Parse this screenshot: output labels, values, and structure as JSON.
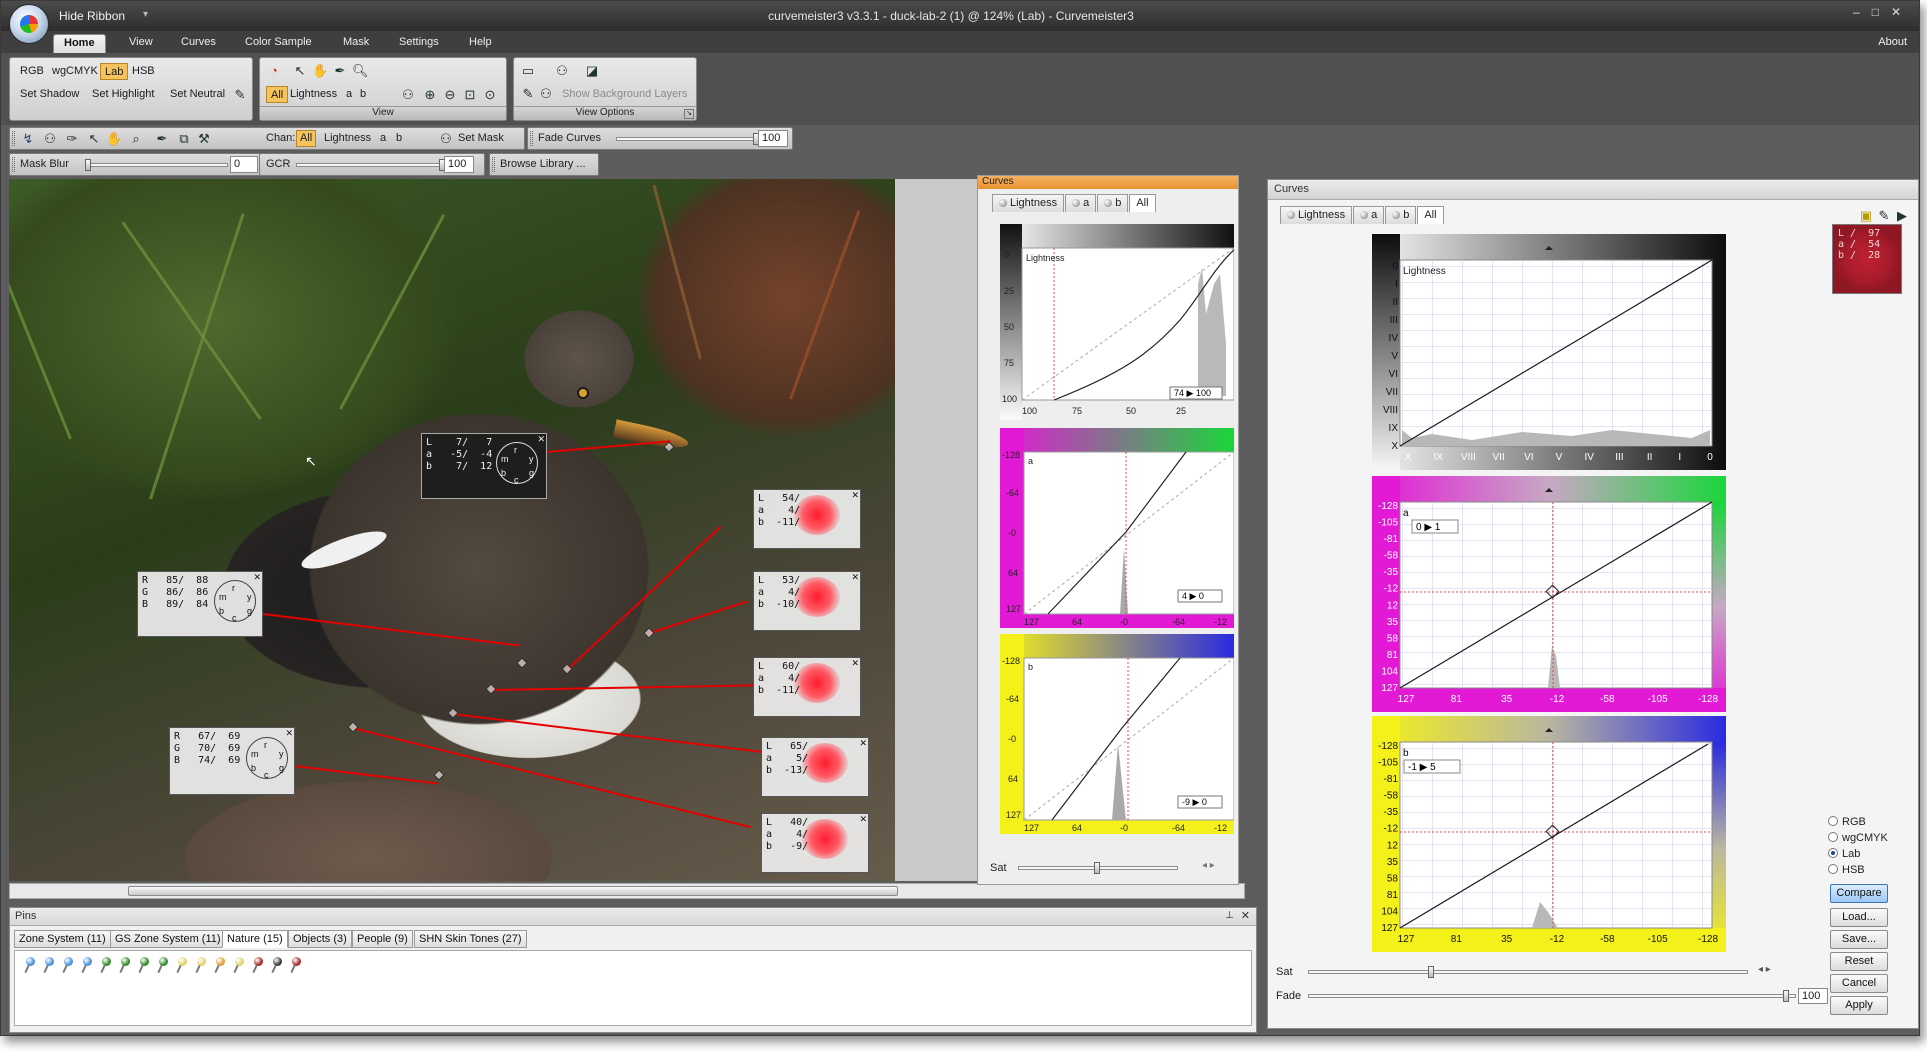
{
  "app": {
    "window_title": "curvemeister3 v3.3.1 - duck-lab-2 (1) @ 124% (Lab) - Curvemeister3",
    "hide_ribbon": "Hide Ribbon",
    "about": "About"
  },
  "ribbon": {
    "tabs": [
      "Home",
      "View",
      "Curves",
      "Color Sample",
      "Mask",
      "Settings",
      "Help"
    ],
    "active_tab": "Home",
    "modes": [
      "RGB",
      "wgCMYK",
      "Lab",
      "HSB"
    ],
    "active_mode": "Lab",
    "set_buttons": [
      "Set Shadow",
      "Set Highlight",
      "Set Neutral"
    ],
    "view_channels": [
      "All",
      "Lightness",
      "a",
      "b"
    ],
    "group_view": "View",
    "show_background_layers": "Show Background Layers",
    "group_view_options": "View Options"
  },
  "toolbar1": {
    "chan_label": "Chan:",
    "channels": [
      "All",
      "Lightness",
      "a",
      "b"
    ],
    "set_mask": "Set Mask",
    "fade_curves": "Fade Curves",
    "fade_value": "100",
    "fade_fraction": 1.0
  },
  "toolbar2": {
    "mask_blur": "Mask Blur",
    "mask_blur_value": "0",
    "mask_blur_fraction": 0.0,
    "gcr": "GCR",
    "gcr_value": "100",
    "gcr_fraction": 1.0,
    "browse_library": "Browse Library ..."
  },
  "readouts": {
    "lab_box": [
      "L    7/   7",
      "a   -5/  -4",
      "b    7/  12"
    ],
    "rgb_box_1": [
      "R   85/  88",
      "G   86/  86",
      "B   89/  84"
    ],
    "rgb_box_2": [
      "R   67/  69",
      "G   70/  69",
      "B   74/  69"
    ],
    "pin_boxes": [
      [
        "L   54/",
        "a    4/",
        "b  -11/"
      ],
      [
        "L   53/",
        "a    4/",
        "b  -10/"
      ],
      [
        "L   60/",
        "a    4/",
        "b  -11/"
      ],
      [
        "L   65/",
        "a    5/",
        "b  -13/"
      ],
      [
        "L   40/",
        "a    4/",
        "b   -9/"
      ]
    ],
    "dial_letters": [
      "r",
      "y",
      "g",
      "c",
      "b",
      "m"
    ]
  },
  "mini_curves": {
    "title": "Curves",
    "tabs": [
      "Lightness",
      "a",
      "b",
      "All"
    ],
    "active_tab": "All",
    "lightness_label": "Lightness",
    "lightness_y_ticks": [
      "0",
      "25",
      "50",
      "75",
      "100"
    ],
    "lightness_x_ticks": [
      "100",
      "75",
      "50",
      "25"
    ],
    "lightness_io": "74 ▶ 100",
    "a_label": "a",
    "a_y_ticks": [
      "-128",
      "-64",
      "-0",
      "64",
      "127"
    ],
    "a_x_ticks": [
      "127",
      "64",
      "-0",
      "-64",
      "-12"
    ],
    "a_io": "4 ▶ 0",
    "b_label": "b",
    "b_y_ticks": [
      "-128",
      "-64",
      "-0",
      "64",
      "127"
    ],
    "b_x_ticks": [
      "127",
      "64",
      "-0",
      "-64",
      "-12"
    ],
    "b_io": "-9 ▶ 0",
    "sat": "Sat"
  },
  "curves_window": {
    "title": "Curves",
    "tabs": [
      "Lightness",
      "a",
      "b",
      "All"
    ],
    "active_tab": "All",
    "lightness_label": "Lightness",
    "lightness_y": [
      "0",
      "I",
      "II",
      "III",
      "IV",
      "V",
      "VI",
      "VII",
      "VIII",
      "IX",
      "X"
    ],
    "lightness_x": [
      "X",
      "IX",
      "VIII",
      "VII",
      "VI",
      "V",
      "IV",
      "III",
      "II",
      "I",
      "0"
    ],
    "a_label": "a",
    "a_io": "0 ▶ 1",
    "ab_y": [
      "-128",
      "-105",
      "-81",
      "-58",
      "-35",
      "-12",
      "12",
      "35",
      "58",
      "81",
      "104",
      "127"
    ],
    "ab_x": [
      "127",
      "81",
      "35",
      "-12",
      "-58",
      "-105",
      "-128"
    ],
    "b_label": "b",
    "b_io": "-1 ▶ 5",
    "lab_values": [
      "L /  97",
      "a /  54",
      "b /  28"
    ],
    "modes": [
      "RGB",
      "wgCMYK",
      "Lab",
      "HSB"
    ],
    "selected_mode": "Lab",
    "buttons": [
      "Compare",
      "Load...",
      "Save...",
      "Reset",
      "Cancel",
      "Apply"
    ],
    "sat": "Sat",
    "fade": "Fade",
    "fade_value": "100",
    "sat_fraction": 0.28,
    "fade_fraction": 0.98
  },
  "pins_panel": {
    "title": "Pins",
    "tabs": [
      "Zone System (11)",
      "GS Zone System (11)",
      "Nature (15)",
      "Objects (3)",
      "People (9)",
      "SHN Skin Tones (27)"
    ],
    "active_tab": "Nature (15)",
    "pin_colors": [
      "#4a8fe0",
      "#4a8fe0",
      "#4a8fe0",
      "#4a8fe0",
      "#2f8a2a",
      "#2f8a2a",
      "#2f8a2a",
      "#2f8a2a",
      "#e3d36b",
      "#e3d36b",
      "#e39a3b",
      "#e3d36b",
      "#a52a2a",
      "#3a3a3a",
      "#a52a2a"
    ]
  },
  "colors": {
    "pin_line": "#e50000",
    "accent_orange": "#f4c35b",
    "magenta": "#e21ad6",
    "green": "#1ad63a",
    "yellow": "#f4f01a",
    "blue": "#2a2ae0"
  }
}
